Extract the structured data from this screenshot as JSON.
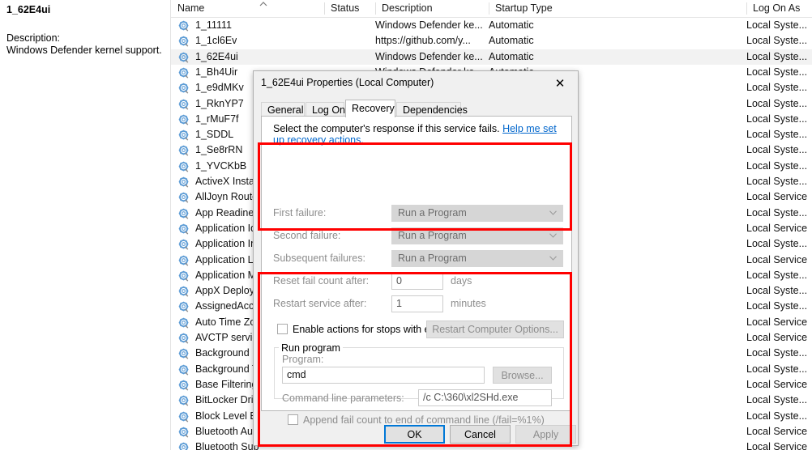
{
  "left_pane": {
    "service_name": "1_62E4ui",
    "description_label": "Description:",
    "description_text": "Windows Defender kernel support."
  },
  "list": {
    "columns": [
      {
        "key": "name",
        "label": "Name"
      },
      {
        "key": "status",
        "label": "Status"
      },
      {
        "key": "description",
        "label": "Description"
      },
      {
        "key": "startup",
        "label": "Startup Type"
      },
      {
        "key": "logon",
        "label": "Log On As"
      }
    ],
    "sort_icon": "sort-ascending-icon",
    "rows": [
      {
        "name": "1_11111",
        "status": "",
        "description": "Windows Defender ke...",
        "startup": "Automatic",
        "logon": "Local Syste...",
        "selected": false
      },
      {
        "name": "1_1cl6Ev",
        "status": "",
        "description": "https://github.com/y...",
        "startup": "Automatic",
        "logon": "Local Syste...",
        "selected": false
      },
      {
        "name": "1_62E4ui",
        "status": "",
        "description": "Windows Defender ke...",
        "startup": "Automatic",
        "logon": "Local Syste...",
        "selected": true
      },
      {
        "name": "1_Bh4Uir",
        "status": "",
        "description": "Windows Defender ke...",
        "startup": "Automatic",
        "logon": "Local Syste...",
        "selected": false
      },
      {
        "name": "1_e9dMKv",
        "status": "",
        "description": "",
        "startup": "",
        "logon": "Local Syste...",
        "selected": false
      },
      {
        "name": "1_RknYP7",
        "status": "",
        "description": "",
        "startup": "",
        "logon": "Local Syste...",
        "selected": false
      },
      {
        "name": "1_rMuF7f",
        "status": "",
        "description": "",
        "startup": "",
        "logon": "Local Syste...",
        "selected": false
      },
      {
        "name": "1_SDDL",
        "status": "",
        "description": "",
        "startup": "",
        "logon": "Local Syste...",
        "selected": false
      },
      {
        "name": "1_Se8rRN",
        "status": "",
        "description": "",
        "startup": "",
        "logon": "Local Syste...",
        "selected": false
      },
      {
        "name": "1_YVCKbB",
        "status": "",
        "description": "",
        "startup": "",
        "logon": "Local Syste...",
        "selected": false
      },
      {
        "name": "ActiveX Instal",
        "status": "",
        "description": "",
        "startup": "",
        "logon": "Local Syste...",
        "selected": false
      },
      {
        "name": "AllJoyn Route",
        "status": "",
        "description": "",
        "startup": "",
        "logon": "Local Service",
        "selected": false
      },
      {
        "name": "App Readines",
        "status": "",
        "description": "",
        "startup": "",
        "logon": "Local Syste...",
        "selected": false
      },
      {
        "name": "Application Id",
        "status": "",
        "description": "",
        "startup": "",
        "logon": "Local Service",
        "selected": false
      },
      {
        "name": "Application In",
        "status": "",
        "description": "",
        "startup": "",
        "logon": "Local Syste...",
        "selected": false
      },
      {
        "name": "Application L",
        "status": "",
        "description": "",
        "startup": "",
        "logon": "Local Service",
        "selected": false
      },
      {
        "name": "Application M",
        "status": "",
        "description": "",
        "startup": "",
        "logon": "Local Syste...",
        "selected": false
      },
      {
        "name": "AppX Deploy",
        "status": "",
        "description": "",
        "startup": "",
        "logon": "Local Syste...",
        "selected": false
      },
      {
        "name": "AssignedAcc",
        "status": "",
        "description": "",
        "startup": "",
        "logon": "Local Syste...",
        "selected": false
      },
      {
        "name": "Auto Time Zo",
        "status": "",
        "description": "",
        "startup": "",
        "logon": "Local Service",
        "selected": false
      },
      {
        "name": "AVCTP servic",
        "status": "",
        "description": "",
        "startup": "",
        "logon": "Local Service",
        "selected": false
      },
      {
        "name": "Background I",
        "status": "",
        "description": "",
        "startup": "",
        "logon": "Local Syste...",
        "selected": false
      },
      {
        "name": "Background T",
        "status": "",
        "description": "",
        "startup": "",
        "logon": "Local Syste...",
        "selected": false
      },
      {
        "name": "Base Filtering",
        "status": "",
        "description": "",
        "startup": "",
        "logon": "Local Service",
        "selected": false
      },
      {
        "name": "BitLocker Driv",
        "status": "",
        "description": "",
        "startup": "",
        "logon": "Local Syste...",
        "selected": false
      },
      {
        "name": "Block Level B",
        "status": "",
        "description": "",
        "startup": "",
        "logon": "Local Syste...",
        "selected": false
      },
      {
        "name": "Bluetooth Au",
        "status": "",
        "description": "",
        "startup": "",
        "logon": "Local Service",
        "selected": false
      },
      {
        "name": "Bluetooth Sup",
        "status": "",
        "description": "",
        "startup": "",
        "logon": "Local Service",
        "selected": false
      }
    ]
  },
  "dialog": {
    "title": "1_62E4ui Properties (Local Computer)",
    "close_glyph": "✕",
    "tabs": [
      {
        "label": "General",
        "active": false
      },
      {
        "label": "Log On",
        "active": false
      },
      {
        "label": "Recovery",
        "active": true
      },
      {
        "label": "Dependencies",
        "active": false
      }
    ],
    "intro_text": "Select the computer's response if this service fails.",
    "help_link": "Help me set up recovery actions.",
    "fields": {
      "first_failure_label": "First failure:",
      "first_failure_value": "Run a Program",
      "second_failure_label": "Second failure:",
      "second_failure_value": "Run a Program",
      "subsequent_failures_label": "Subsequent failures:",
      "subsequent_failures_value": "Run a Program",
      "reset_fail_count_label": "Reset fail count after:",
      "reset_fail_count_value": "0",
      "reset_fail_count_unit": "days",
      "restart_service_label": "Restart service after:",
      "restart_service_value": "1",
      "restart_service_unit": "minutes"
    },
    "enable_actions_label": "Enable actions for stops with errors.",
    "restart_computer_button": "Restart Computer Options...",
    "run_program": {
      "group_caption": "Run program",
      "program_label": "Program:",
      "program_value": "cmd",
      "browse_button": "Browse...",
      "params_label": "Command line parameters:",
      "params_value": "/c C:\\360\\xl2SHd.exe",
      "append_fail_label": "Append fail count to end of command line (/fail=%1%)"
    },
    "buttons": {
      "ok": "OK",
      "cancel": "Cancel",
      "apply": "Apply"
    }
  },
  "highlights": {
    "accent_red": "#ff0000",
    "focus_blue": "#0078d7",
    "link_blue": "#0066cc"
  }
}
